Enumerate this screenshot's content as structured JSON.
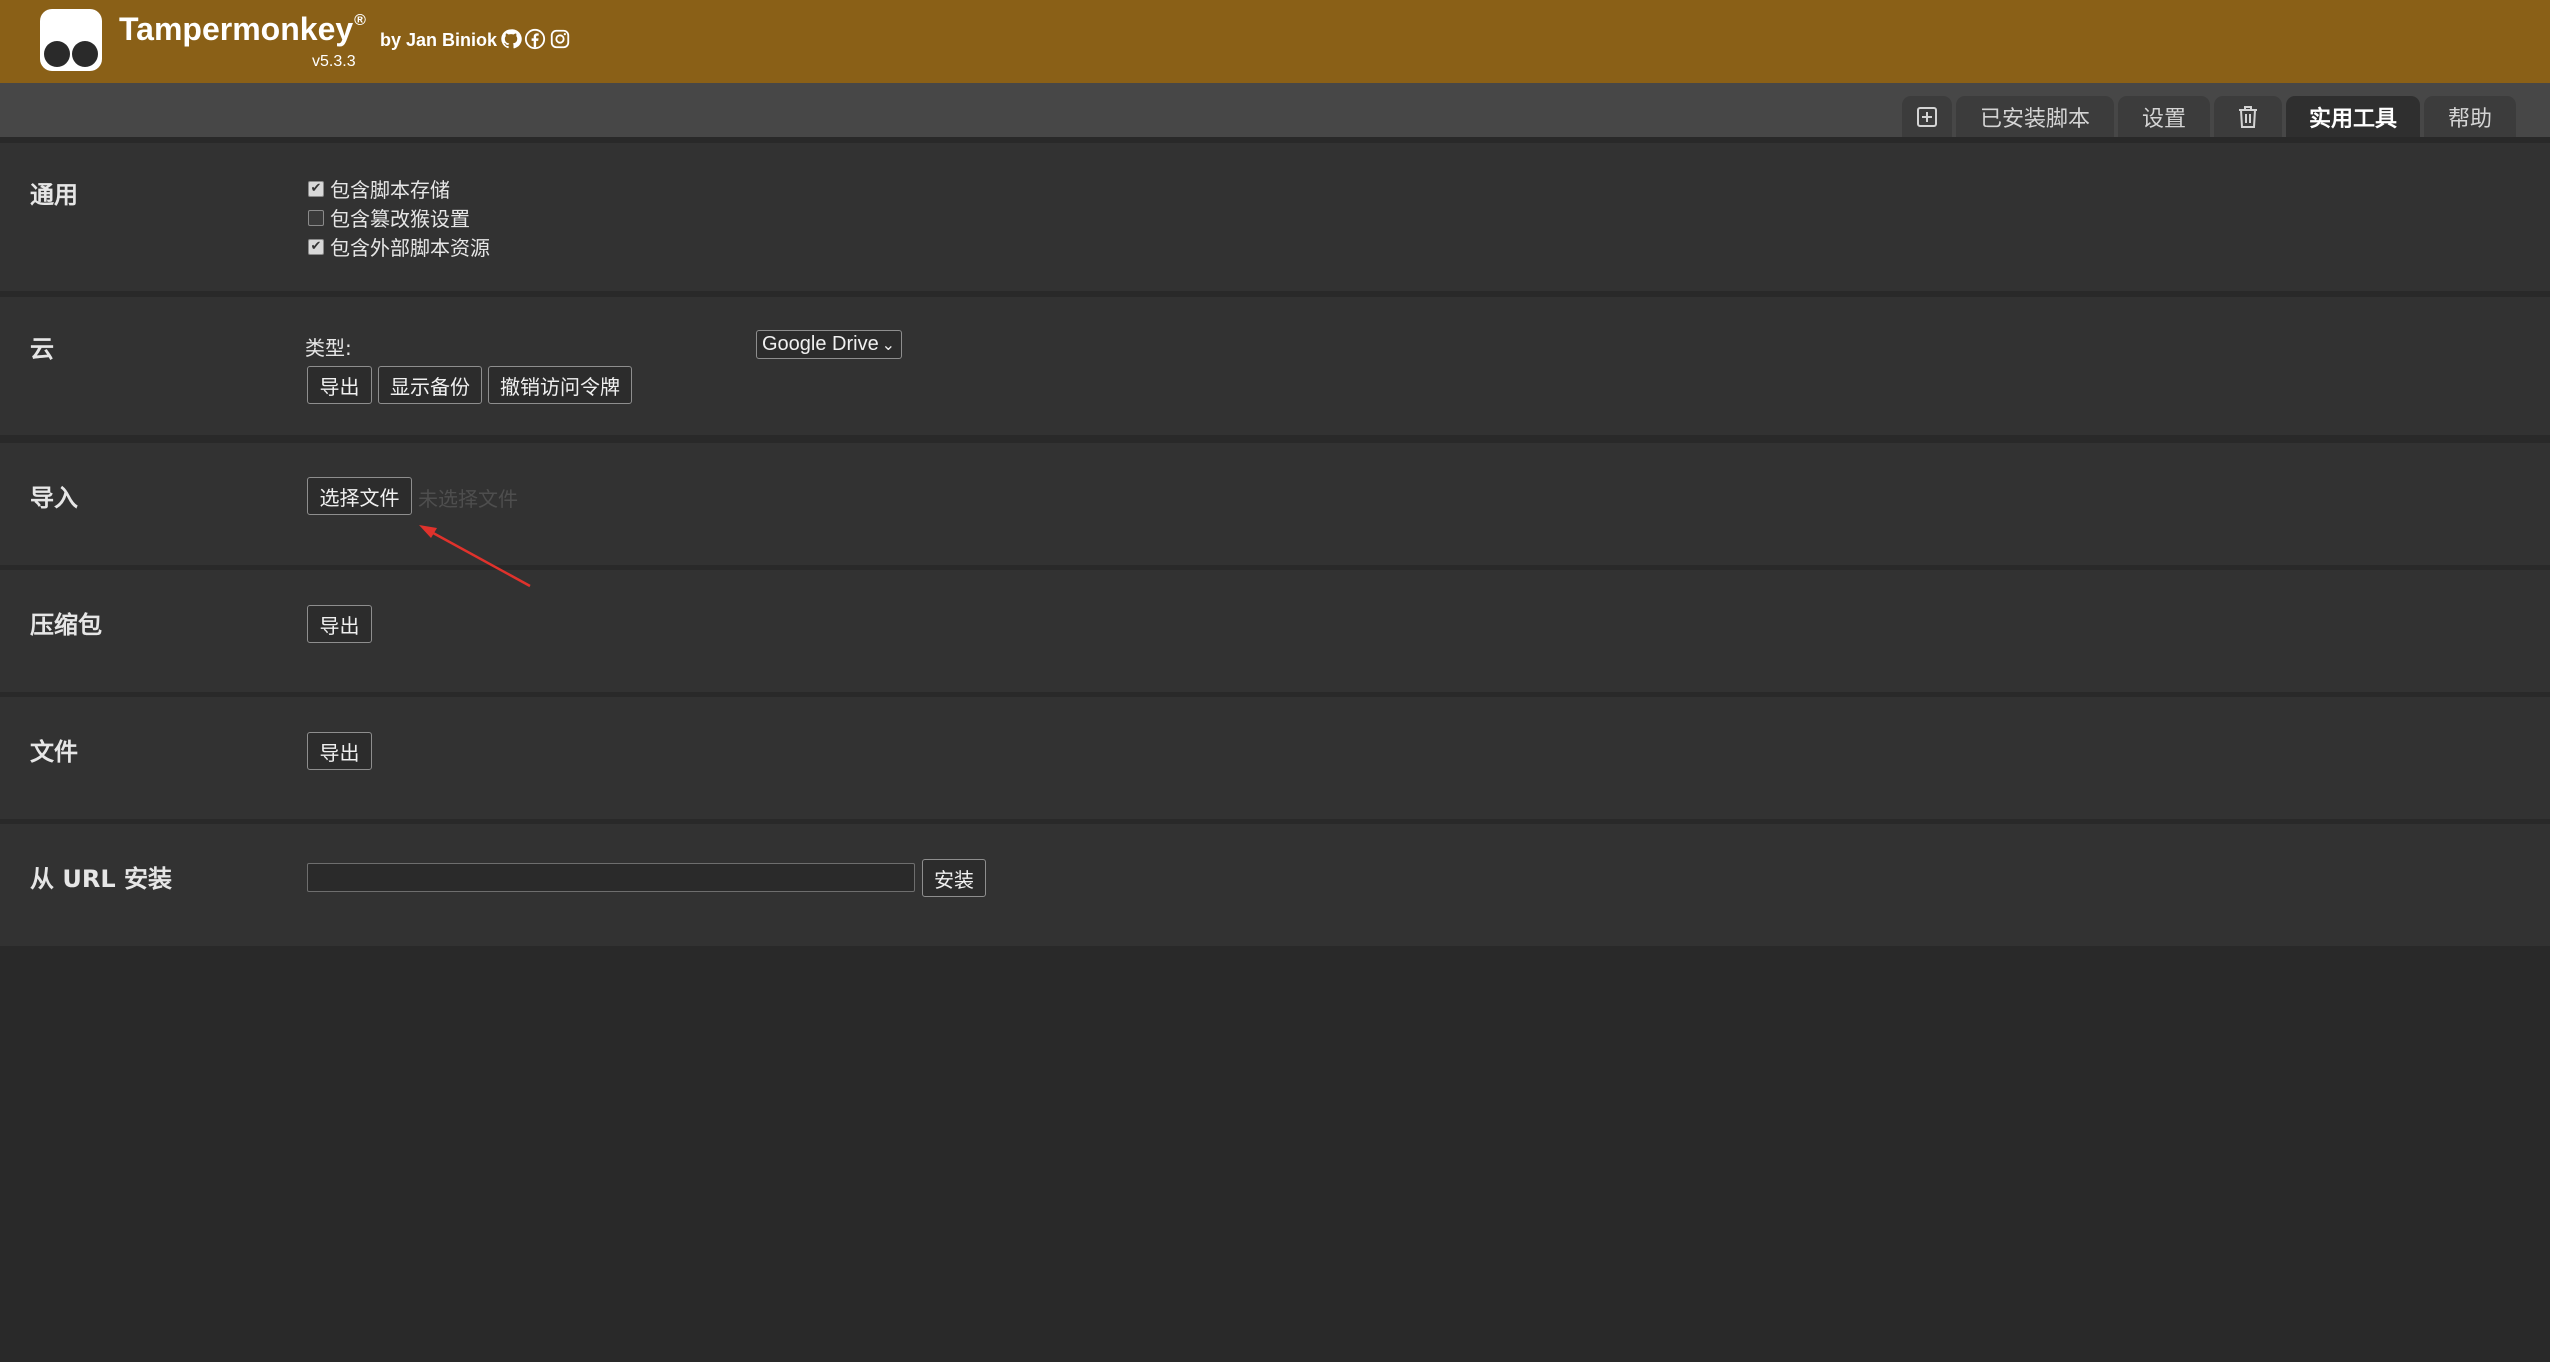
{
  "header": {
    "app_name": "Tampermonkey",
    "registered_mark": "®",
    "author": "by Jan Biniok",
    "version": "v5.3.3",
    "social_icons": [
      "github-icon",
      "facebook-icon",
      "instagram-icon"
    ],
    "background_color": "#8a6017"
  },
  "tabs": [
    {
      "icon": "new-script-icon",
      "label": ""
    },
    {
      "label": "已安装脚本"
    },
    {
      "label": "设置"
    },
    {
      "icon": "trash-icon",
      "label": ""
    },
    {
      "label": "实用工具",
      "active": true
    },
    {
      "label": "帮助"
    }
  ],
  "sections": {
    "general": {
      "title": "通用",
      "options": [
        {
          "label": "包含脚本存储",
          "checked": true
        },
        {
          "label": "包含篡改猴设置",
          "checked": false
        },
        {
          "label": "包含外部脚本资源",
          "checked": true
        }
      ]
    },
    "cloud": {
      "title": "云",
      "type_label": "类型:",
      "type_value": "Google Drive",
      "buttons": {
        "export": "导出",
        "show_backup": "显示备份",
        "revoke_token": "撤销访问令牌"
      }
    },
    "import": {
      "title": "导入",
      "choose_file_label": "选择文件",
      "no_file_text": "未选择文件"
    },
    "zip": {
      "title": "压缩包",
      "export_label": "导出"
    },
    "file": {
      "title": "文件",
      "export_label": "导出"
    },
    "install_url": {
      "title": "从 URL 安装",
      "input_value": "",
      "install_label": "安装"
    }
  },
  "annotation": {
    "arrow_color": "#e0322c"
  }
}
